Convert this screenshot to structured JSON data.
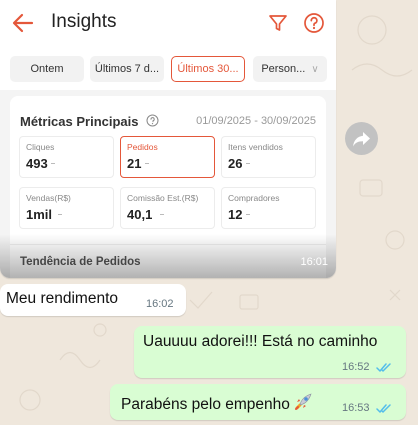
{
  "image_message": {
    "app": {
      "title": "Insights",
      "date_chips": [
        {
          "label": "Ontem",
          "active": false
        },
        {
          "label": "Últimos 7 d...",
          "active": false
        },
        {
          "label": "Últimos 30...",
          "active": true
        },
        {
          "label": "Person...",
          "active": false
        }
      ],
      "metrics": {
        "title": "Métricas Principais",
        "date_range": "01/09/2025 - 30/09/2025",
        "tiles": [
          {
            "label": "Cliques",
            "value": "493",
            "selected": false
          },
          {
            "label": "Pedidos",
            "value": "21",
            "selected": true
          },
          {
            "label": "Itens vendidos",
            "value": "26",
            "selected": false
          },
          {
            "label": "Vendas(R$)",
            "value": "1mil",
            "selected": false
          },
          {
            "label": "Comissão Est.(R$)",
            "value": "40,1",
            "selected": false
          },
          {
            "label": "Compradores",
            "value": "12",
            "selected": false
          }
        ]
      },
      "trend_title": "Tendência de Pedidos"
    },
    "time": "16:01"
  },
  "messages": [
    {
      "direction": "in",
      "text": "Meu rendimento",
      "time": "16:02"
    },
    {
      "direction": "out",
      "text": "Uauuuu adorei!!! Está no caminho",
      "time": "16:52",
      "status": "read"
    },
    {
      "direction": "out",
      "text": "Parabéns pelo empenho",
      "emoji": "rocket",
      "time": "16:53",
      "status": "read"
    }
  ],
  "colors": {
    "accent": "#e4573a",
    "chat_background": "#efe7dc",
    "outgoing_bubble": "#d9fdd3",
    "incoming_bubble": "#ffffff",
    "read_ticks": "#53bdeb"
  },
  "icons": [
    "back-arrow-icon",
    "filter-icon",
    "help-icon",
    "info-icon",
    "forward-icon",
    "double-check-icon",
    "rocket-emoji"
  ]
}
